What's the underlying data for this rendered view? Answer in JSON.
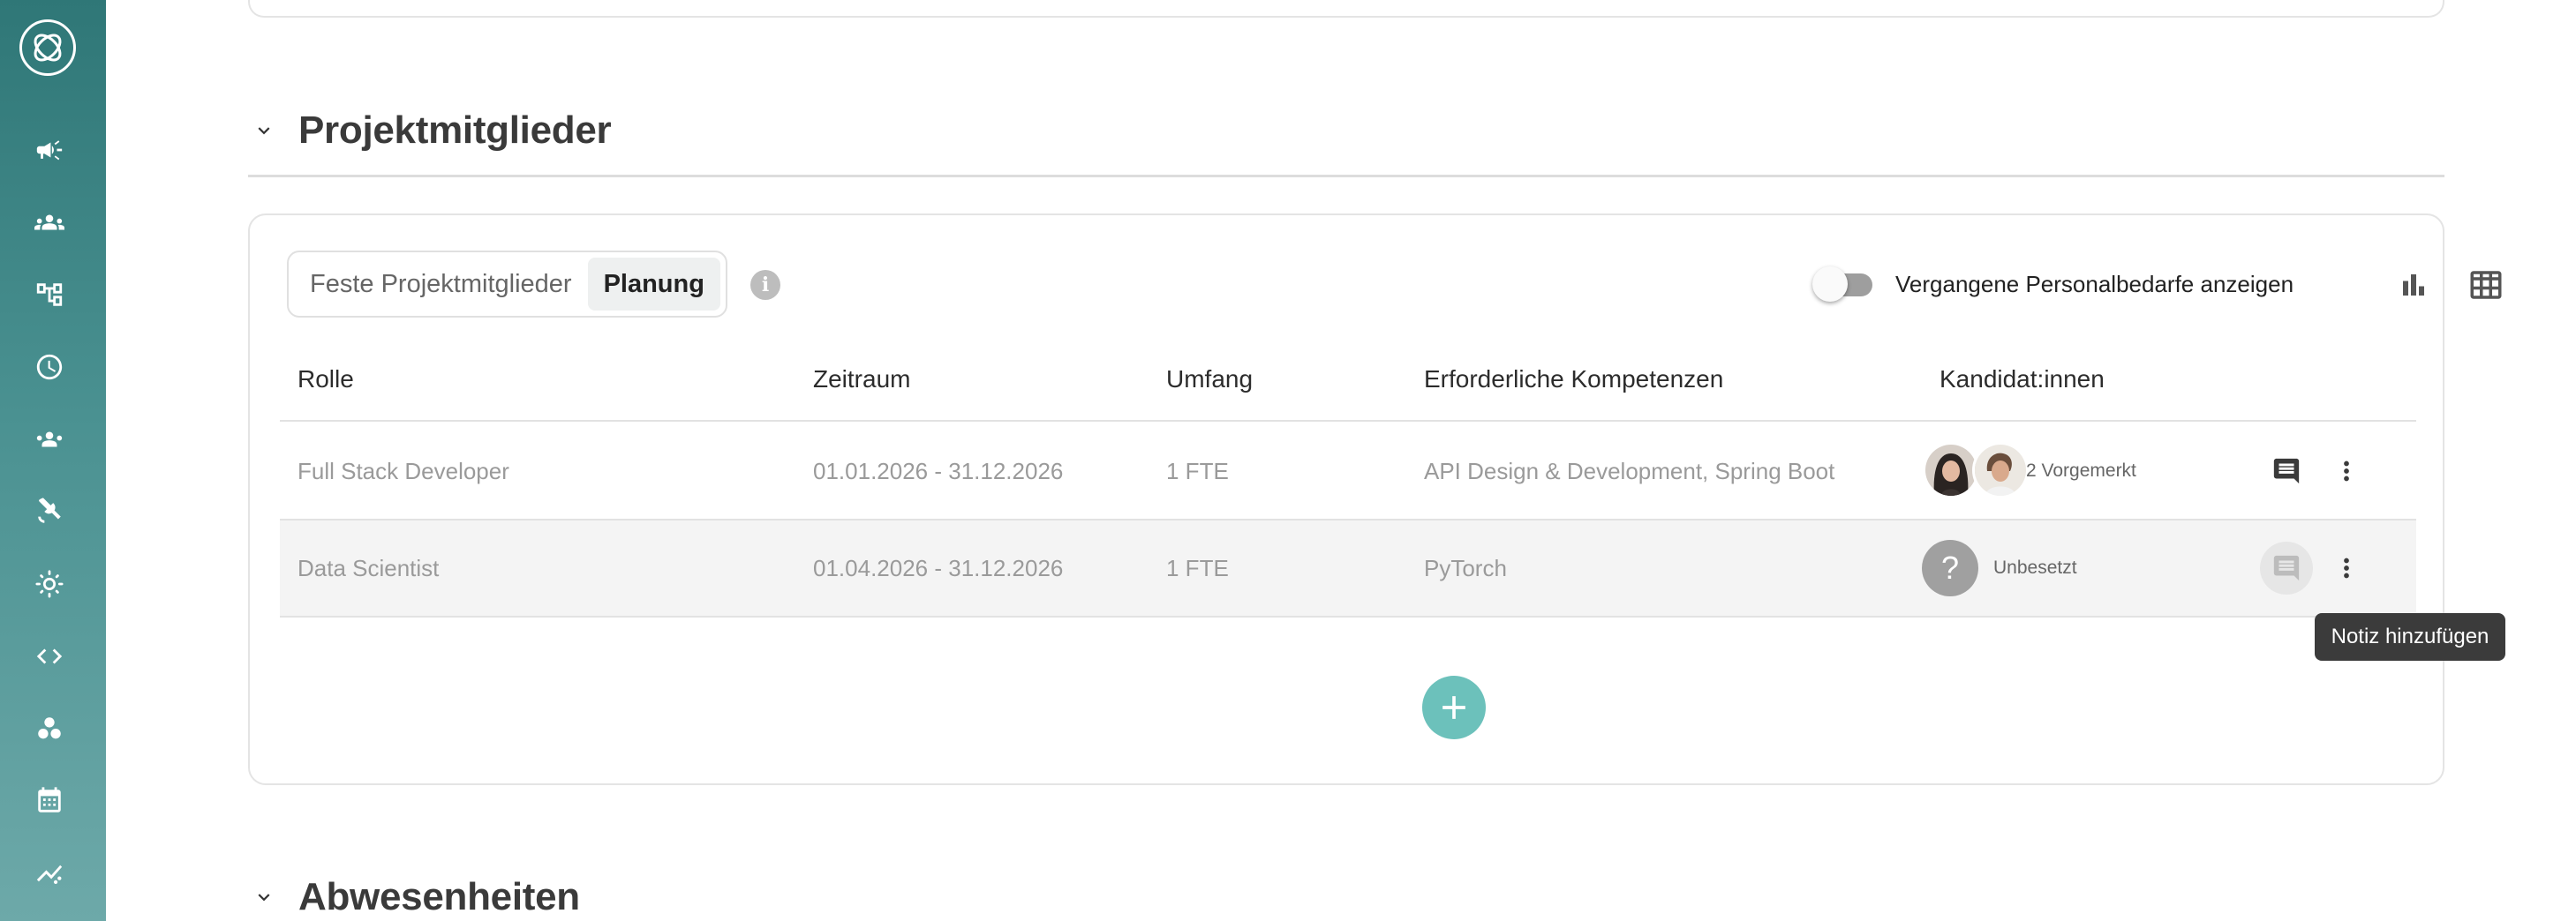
{
  "sidebar": {
    "logo": "app-logo",
    "items": [
      {
        "icon": "megaphone-icon"
      },
      {
        "icon": "group-icon"
      },
      {
        "icon": "hierarchy-icon"
      },
      {
        "icon": "clock-icon"
      },
      {
        "icon": "people-icon"
      },
      {
        "icon": "satellite-icon"
      },
      {
        "icon": "sun-icon"
      },
      {
        "icon": "code-icon"
      },
      {
        "icon": "cluster-icon"
      },
      {
        "icon": "calendar-icon"
      },
      {
        "icon": "trend-icon"
      }
    ]
  },
  "sections": {
    "members_title": "Projektmitglieder",
    "absences_title": "Abwesenheiten"
  },
  "tabs": {
    "fixed": "Feste Projektmitglieder",
    "planning": "Planung",
    "active": "planning"
  },
  "toolbar": {
    "toggle_label": "Vergangene Personalbedarfe anzeigen",
    "toggle_on": false
  },
  "table": {
    "headers": [
      "Rolle",
      "Zeitraum",
      "Umfang",
      "Erforderliche Kompetenzen",
      "Kandidat:innen"
    ],
    "rows": [
      {
        "role": "Full Stack Developer",
        "period": "01.01.2026 - 31.12.2026",
        "scope": "1 FTE",
        "skills": "API Design & Development, Spring Boot",
        "candidates": "2 Vorgemerkt"
      },
      {
        "role": "Data Scientist",
        "period": "01.04.2026 - 31.12.2026",
        "scope": "1 FTE",
        "skills": "PyTorch",
        "candidates": "Unbesetzt"
      }
    ]
  },
  "tooltip": "Notiz hinzufügen",
  "colors": {
    "sidebar_top": "#2f7777",
    "sidebar_bottom": "#6da9a9",
    "accent": "#6cc1bb"
  }
}
